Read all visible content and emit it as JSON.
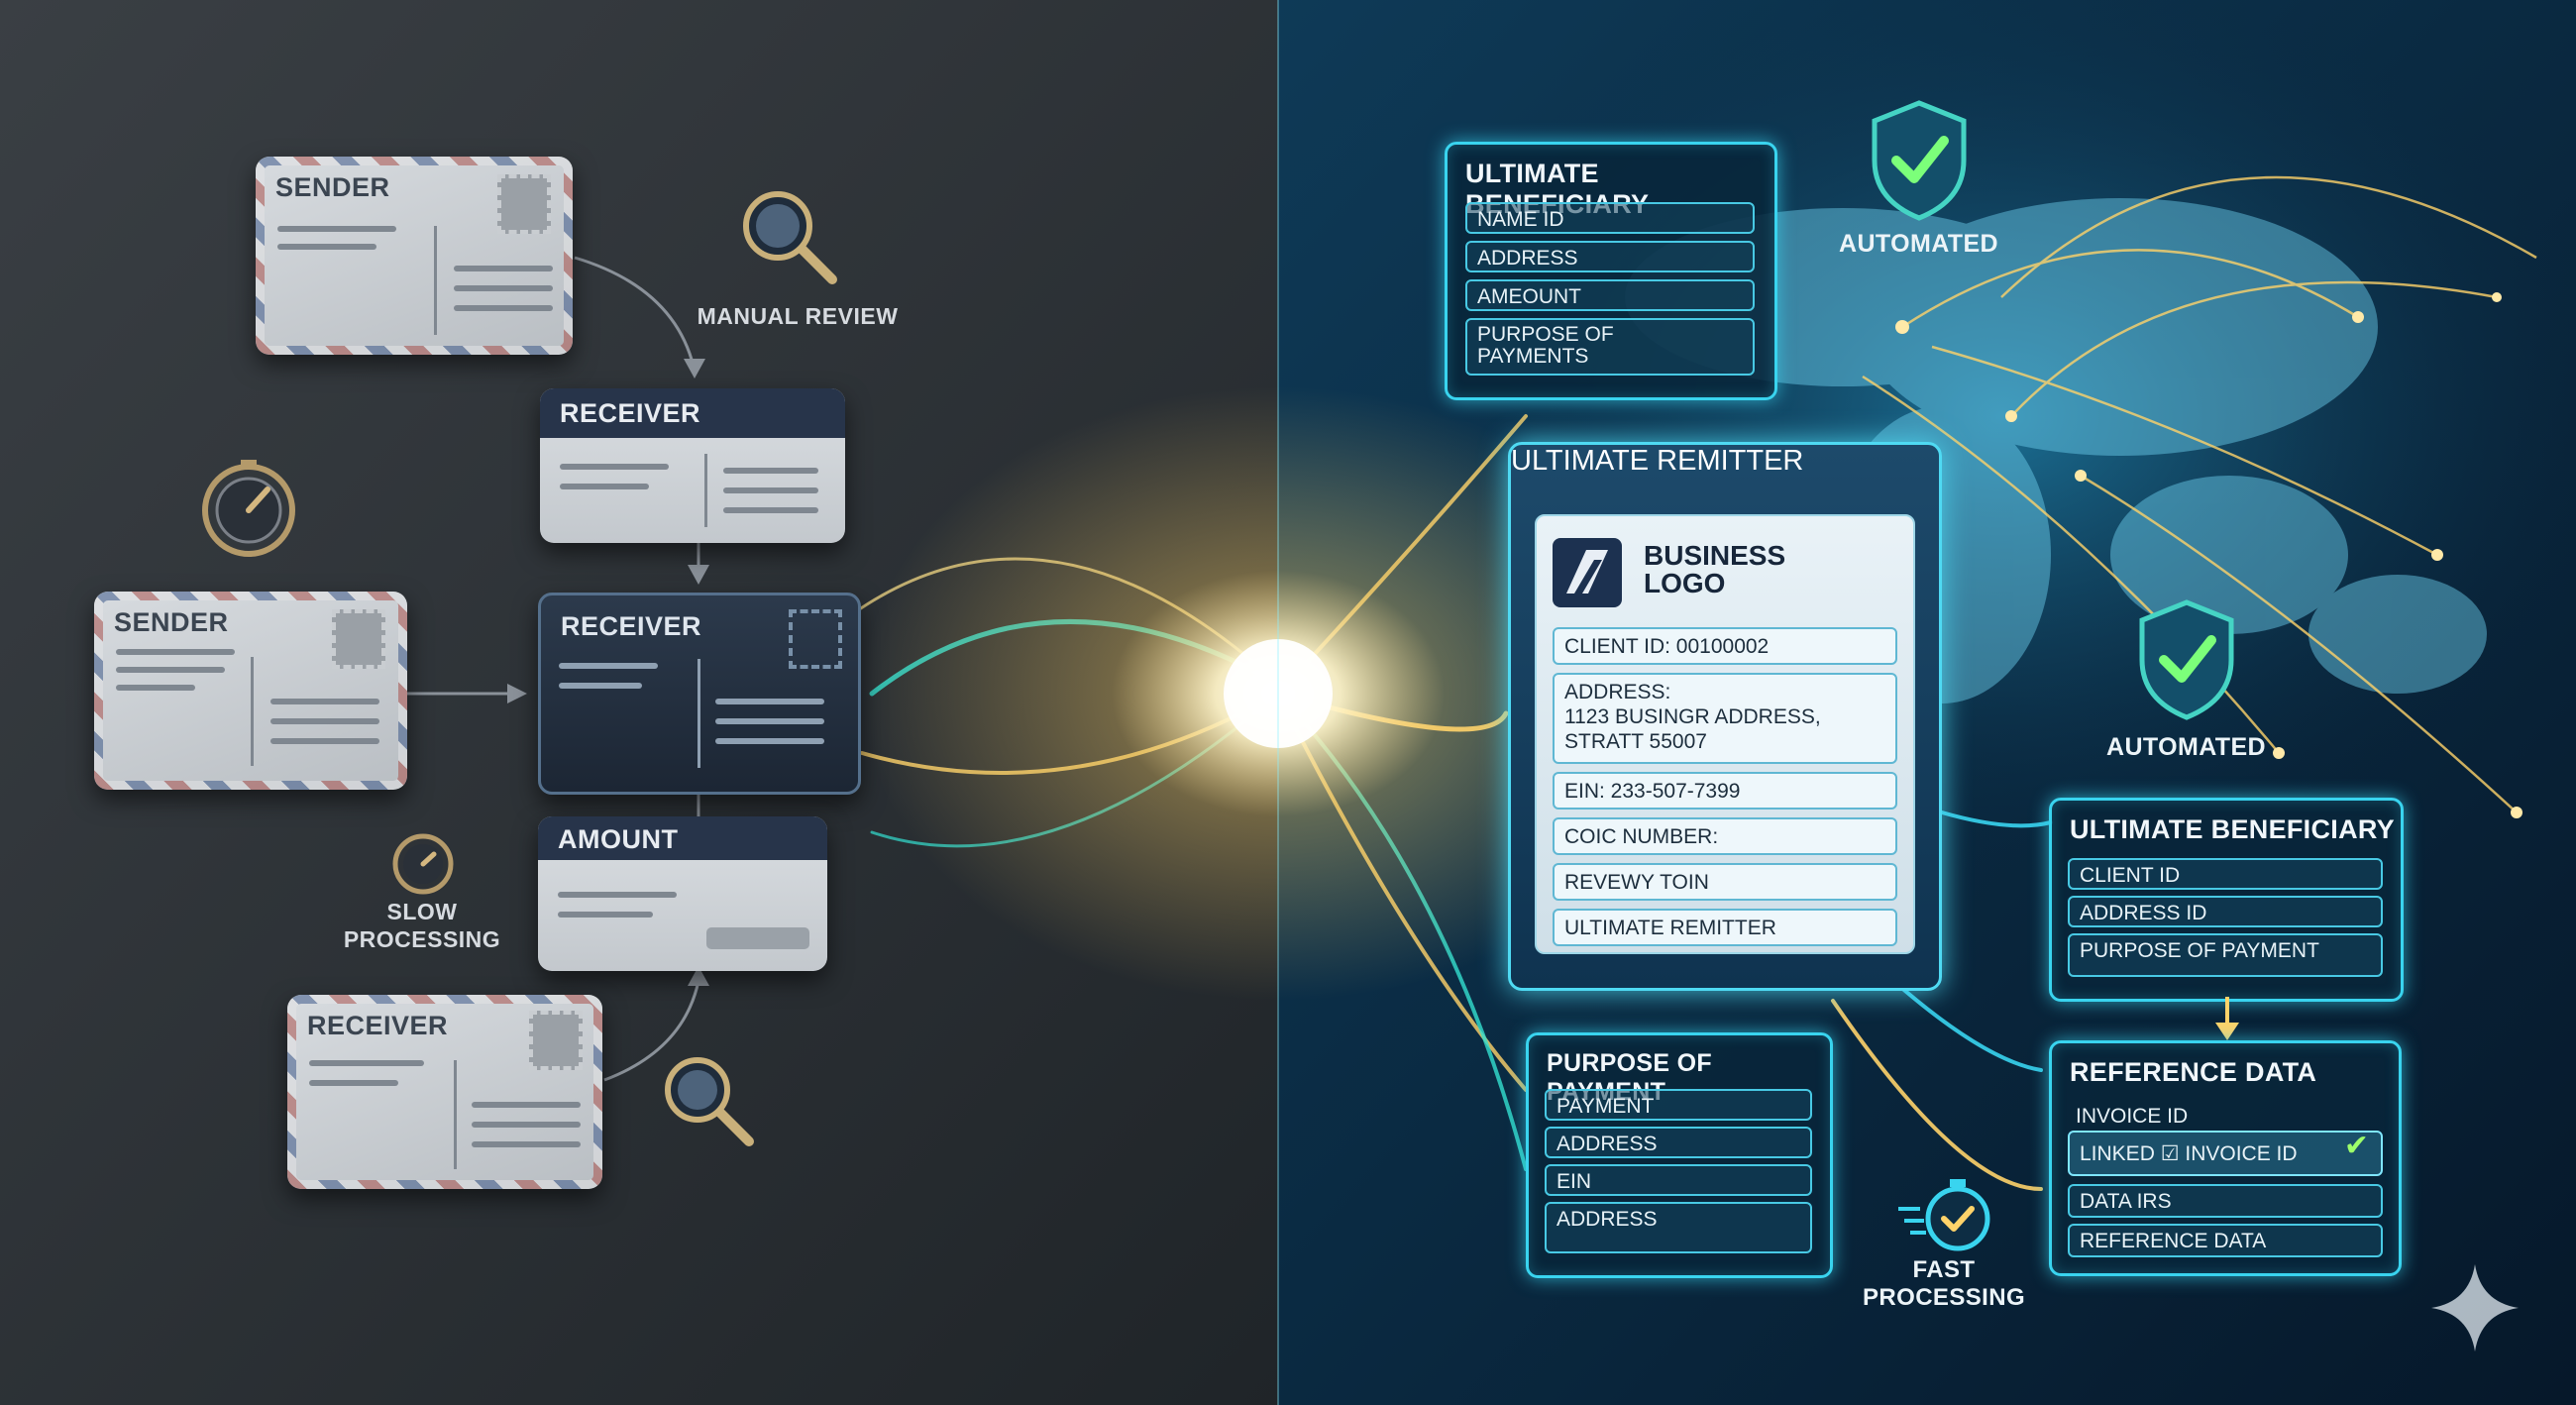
{
  "left": {
    "cards": [
      {
        "title": "SENDER"
      },
      {
        "title": "RECEIVER"
      },
      {
        "title": "SENDER"
      },
      {
        "title": "RECEIVER"
      },
      {
        "title": "AMOUNT"
      },
      {
        "title": "RECEIVER"
      }
    ],
    "labels": {
      "manual_review": "MANUAL REVIEW",
      "slow_processing": "SLOW\nPROCESSING"
    }
  },
  "right": {
    "top_beneficiary": {
      "title": "ULTIMATE BENEFICIARY",
      "fields": [
        "NAME ID",
        "ADDRESS",
        "AMEOUNT",
        "PURPOSE OF\nPAYMENTS"
      ]
    },
    "remitter": {
      "title": "ULTIMATE REMITTER",
      "logo_text": "BUSINESS\nLOGO",
      "fields": [
        "CLIENT ID: 00100002",
        "ADDRESS:\n1123 BUSINGR ADDRESS,\nSTRATT 55007",
        "EIN: 233-507-7399",
        "COIC NUMBER:",
        "REVEWY TOIN",
        "ULTIMATE REMITTER"
      ]
    },
    "purpose": {
      "title": "PURPOSE OF PAYMENT",
      "fields": [
        "PAYMENT",
        "ADDRESS",
        "EIN",
        "ADDRESS"
      ]
    },
    "beneficiary": {
      "title": "ULTIMATE BENEFICIARY",
      "fields": [
        "CLIENT ID",
        "ADDRESS ID",
        "PURPOSE OF PAYMENT"
      ]
    },
    "reference": {
      "title": "REFERENCE DATA",
      "fields": [
        "INVOICE ID",
        "LINKED ☑ INVOICE ID",
        "DATA IRS",
        "REFERENCE DATA"
      ]
    },
    "labels": {
      "automated_top": "AUTOMATED",
      "automated_mid": "AUTOMATED",
      "fast_processing": "FAST\nPROCESSING"
    }
  },
  "colors": {
    "left_bg": "#2b3035",
    "right_bg": "#0b2b44",
    "neon": "#39d4ef",
    "gold": "#ffd36a",
    "check_green": "#9dff6a"
  }
}
